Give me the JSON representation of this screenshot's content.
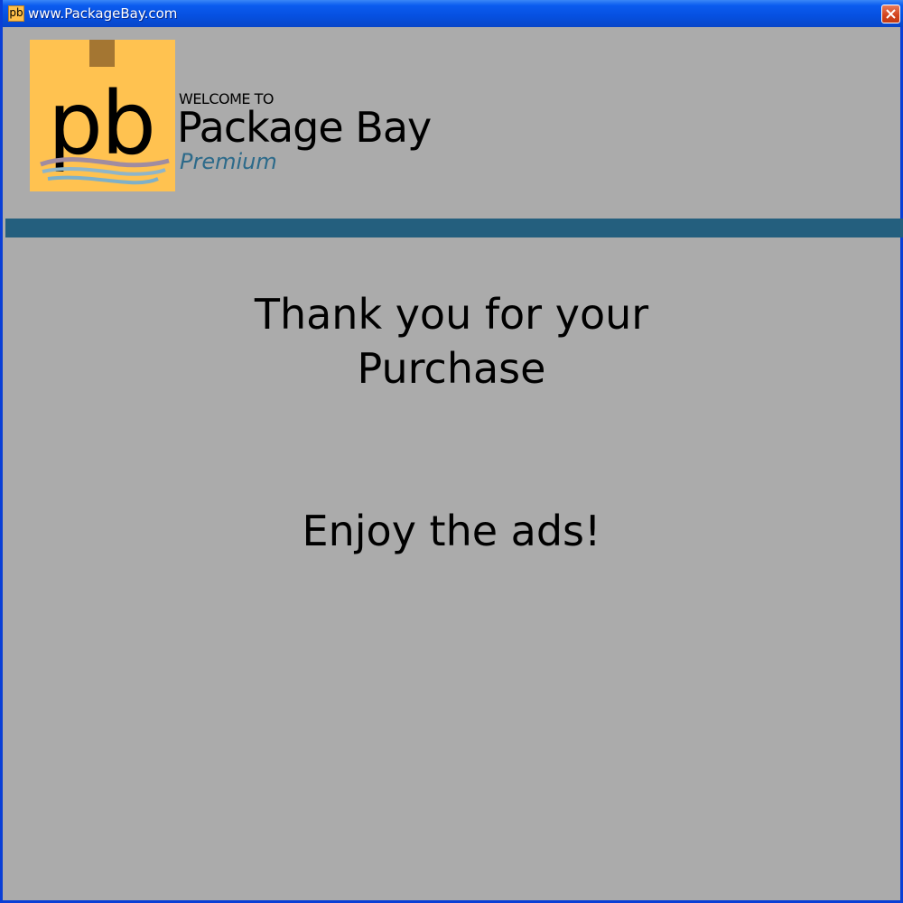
{
  "window": {
    "title": "www.PackageBay.com",
    "app_icon_text": "pb",
    "close_icon": "close-icon",
    "titlebar_color": "#0650e0",
    "border_color": "#0a3fd6",
    "background_color": "#ababab"
  },
  "header": {
    "logo_letters": "pb",
    "logo_background_color": "#ffc250",
    "welcome": "WELCOME TO",
    "brand": "Package Bay",
    "tier": "Premium",
    "tier_color": "#2c6a8a",
    "divider_color": "#245f7e"
  },
  "main": {
    "thanks_line1": "Thank you for your",
    "thanks_line2": "Purchase",
    "message": "Enjoy the ads!"
  }
}
